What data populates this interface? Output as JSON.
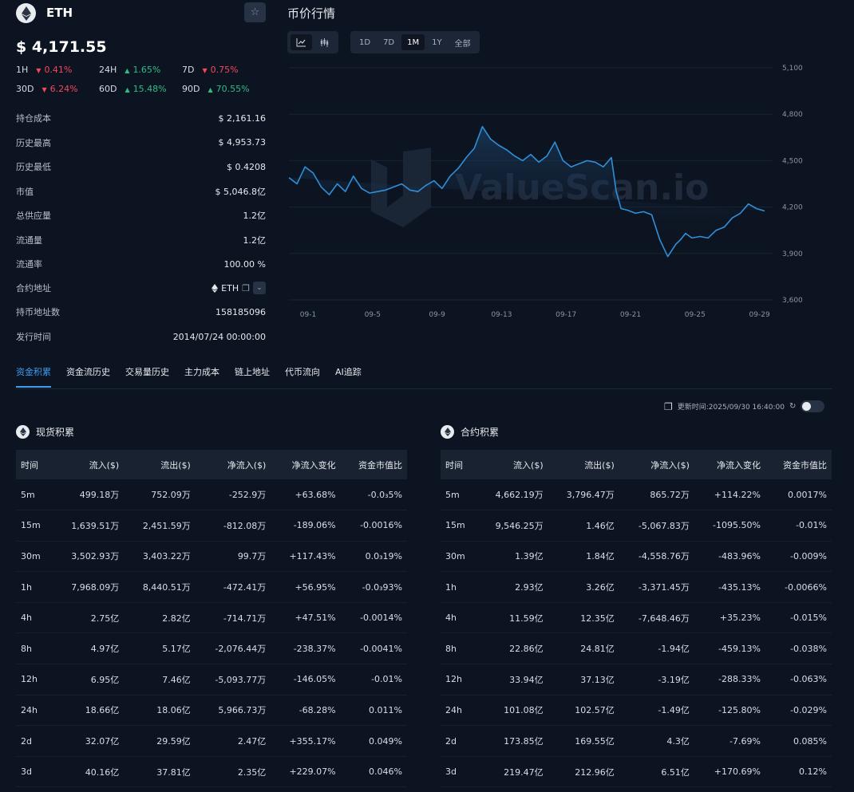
{
  "coin": {
    "symbol": "ETH",
    "price": "$ 4,171.55",
    "changes": [
      {
        "period": "1H",
        "value": "0.41%",
        "dir": "down"
      },
      {
        "period": "24H",
        "value": "1.65%",
        "dir": "up"
      },
      {
        "period": "7D",
        "value": "0.75%",
        "dir": "down"
      },
      {
        "period": "30D",
        "value": "6.24%",
        "dir": "down"
      },
      {
        "period": "60D",
        "value": "15.48%",
        "dir": "up"
      },
      {
        "period": "90D",
        "value": "70.55%",
        "dir": "up"
      }
    ],
    "info": [
      {
        "label": "持仓成本",
        "value": "$ 2,161.16"
      },
      {
        "label": "历史最高",
        "value": "$ 4,953.73"
      },
      {
        "label": "历史最低",
        "value": "$ 0.4208"
      },
      {
        "label": "市值",
        "value": "$ 5,046.8亿"
      },
      {
        "label": "总供应量",
        "value": "1.2亿"
      },
      {
        "label": "流通量",
        "value": "1.2亿"
      },
      {
        "label": "流通率",
        "value": "100.00 %"
      }
    ],
    "contract_label": "合约地址",
    "contract_value": "ETH",
    "holders_label": "持币地址数",
    "holders_value": "158185096",
    "issue_label": "发行时间",
    "issue_value": "2014/07/24 00:00:00"
  },
  "price_chart": {
    "title": "币价行情",
    "chart_types": [
      "line-chart-icon",
      "candlestick-icon"
    ],
    "ranges": [
      "1D",
      "7D",
      "1M",
      "1Y",
      "全部"
    ],
    "active_range": "1M",
    "watermark": "ValueScan.io",
    "line_color": "#2f8fd8"
  },
  "chart_data": {
    "type": "line",
    "x_ticks": [
      "09-1",
      "09-5",
      "09-9",
      "09-13",
      "09-17",
      "09-21",
      "09-25",
      "09-29"
    ],
    "y_ticks": [
      "5,100",
      "4,800",
      "4,500",
      "4,200",
      "3,900",
      "3,600"
    ],
    "ylim": [
      3600,
      5100
    ],
    "x": [
      0,
      0.5,
      1,
      1.5,
      2,
      2.5,
      3,
      3.5,
      4,
      4.5,
      5,
      5.5,
      6,
      6.5,
      7,
      7.5,
      8,
      8.5,
      9,
      9.5,
      10,
      10.5,
      11,
      11.5,
      12,
      12.5,
      13,
      13.5,
      14,
      14.5,
      15,
      15.5,
      16,
      16.5,
      17,
      17.5,
      18,
      18.5,
      19,
      19.5,
      20,
      20.3,
      20.6,
      21,
      21.5,
      22,
      22.5,
      23,
      23.5,
      24,
      24.3,
      24.6,
      25,
      25.5,
      26,
      26.5,
      27,
      27.5,
      28,
      28.5,
      29,
      29.5,
      29.8
    ],
    "values": [
      4390,
      4350,
      4460,
      4420,
      4330,
      4280,
      4350,
      4300,
      4400,
      4320,
      4290,
      4300,
      4310,
      4330,
      4350,
      4310,
      4300,
      4340,
      4370,
      4320,
      4400,
      4450,
      4520,
      4580,
      4720,
      4640,
      4600,
      4570,
      4530,
      4500,
      4540,
      4490,
      4530,
      4620,
      4500,
      4460,
      4480,
      4500,
      4490,
      4460,
      4520,
      4300,
      4190,
      4180,
      4160,
      4170,
      4150,
      3990,
      3880,
      3960,
      3990,
      4030,
      4000,
      4010,
      4000,
      4050,
      4070,
      4130,
      4160,
      4220,
      4190,
      4175
    ]
  },
  "tabs": [
    "资金积累",
    "资金流历史",
    "交易量历史",
    "主力成本",
    "链上地址",
    "代币流向",
    "AI追踪"
  ],
  "active_tab": "资金积累",
  "update_time": "更新时间:2025/09/30 16:40:00",
  "columns": [
    "时间",
    "流入($)",
    "流出($)",
    "净流入($)",
    "净流入变化",
    "资金市值比"
  ],
  "spot": {
    "title": "现货积累",
    "rows": [
      {
        "t": "5m",
        "in": "499.18万",
        "out": "752.09万",
        "net": "-252.9万",
        "chg": "+63.68%",
        "ratio": "-0.0₃5%",
        "net_dir": "down",
        "chg_dir": "up",
        "ratio_dir": "down"
      },
      {
        "t": "15m",
        "in": "1,639.51万",
        "out": "2,451.59万",
        "net": "-812.08万",
        "chg": "-189.06%",
        "ratio": "-0.0016%",
        "net_dir": "down",
        "chg_dir": "down",
        "ratio_dir": "down"
      },
      {
        "t": "30m",
        "in": "3,502.93万",
        "out": "3,403.22万",
        "net": "99.7万",
        "chg": "+117.43%",
        "ratio": "0.0₃19%",
        "net_dir": "up",
        "chg_dir": "up",
        "ratio_dir": "up"
      },
      {
        "t": "1h",
        "in": "7,968.09万",
        "out": "8,440.51万",
        "net": "-472.41万",
        "chg": "+56.95%",
        "ratio": "-0.0₃93%",
        "net_dir": "down",
        "chg_dir": "up",
        "ratio_dir": "down"
      },
      {
        "t": "4h",
        "in": "2.75亿",
        "out": "2.82亿",
        "net": "-714.71万",
        "chg": "+47.51%",
        "ratio": "-0.0014%",
        "net_dir": "down",
        "chg_dir": "up",
        "ratio_dir": "down"
      },
      {
        "t": "8h",
        "in": "4.97亿",
        "out": "5.17亿",
        "net": "-2,076.44万",
        "chg": "-238.37%",
        "ratio": "-0.0041%",
        "net_dir": "down",
        "chg_dir": "down",
        "ratio_dir": "down"
      },
      {
        "t": "12h",
        "in": "6.95亿",
        "out": "7.46亿",
        "net": "-5,093.77万",
        "chg": "-146.05%",
        "ratio": "-0.01%",
        "net_dir": "down",
        "chg_dir": "down",
        "ratio_dir": "down"
      },
      {
        "t": "24h",
        "in": "18.66亿",
        "out": "18.06亿",
        "net": "5,966.73万",
        "chg": "-68.28%",
        "ratio": "0.011%",
        "net_dir": "up",
        "chg_dir": "down",
        "ratio_dir": "up"
      },
      {
        "t": "2d",
        "in": "32.07亿",
        "out": "29.59亿",
        "net": "2.47亿",
        "chg": "+355.17%",
        "ratio": "0.049%",
        "net_dir": "up",
        "chg_dir": "up",
        "ratio_dir": "up"
      },
      {
        "t": "3d",
        "in": "40.16亿",
        "out": "37.81亿",
        "net": "2.35亿",
        "chg": "+229.07%",
        "ratio": "0.046%",
        "net_dir": "up",
        "chg_dir": "up",
        "ratio_dir": "up"
      }
    ]
  },
  "futures": {
    "title": "合约积累",
    "rows": [
      {
        "t": "5m",
        "in": "4,662.19万",
        "out": "3,796.47万",
        "net": "865.72万",
        "chg": "+114.22%",
        "ratio": "0.0017%",
        "net_dir": "up",
        "chg_dir": "up",
        "ratio_dir": "up"
      },
      {
        "t": "15m",
        "in": "9,546.25万",
        "out": "1.46亿",
        "net": "-5,067.83万",
        "chg": "-1095.50%",
        "ratio": "-0.01%",
        "net_dir": "down",
        "chg_dir": "down",
        "ratio_dir": "down"
      },
      {
        "t": "30m",
        "in": "1.39亿",
        "out": "1.84亿",
        "net": "-4,558.76万",
        "chg": "-483.96%",
        "ratio": "-0.009%",
        "net_dir": "down",
        "chg_dir": "down",
        "ratio_dir": "down"
      },
      {
        "t": "1h",
        "in": "2.93亿",
        "out": "3.26亿",
        "net": "-3,371.45万",
        "chg": "-435.13%",
        "ratio": "-0.0066%",
        "net_dir": "down",
        "chg_dir": "down",
        "ratio_dir": "down"
      },
      {
        "t": "4h",
        "in": "11.59亿",
        "out": "12.35亿",
        "net": "-7,648.46万",
        "chg": "+35.23%",
        "ratio": "-0.015%",
        "net_dir": "down",
        "chg_dir": "up",
        "ratio_dir": "down"
      },
      {
        "t": "8h",
        "in": "22.86亿",
        "out": "24.81亿",
        "net": "-1.94亿",
        "chg": "-459.13%",
        "ratio": "-0.038%",
        "net_dir": "down",
        "chg_dir": "down",
        "ratio_dir": "down"
      },
      {
        "t": "12h",
        "in": "33.94亿",
        "out": "37.13亿",
        "net": "-3.19亿",
        "chg": "-288.33%",
        "ratio": "-0.063%",
        "net_dir": "down",
        "chg_dir": "down",
        "ratio_dir": "down"
      },
      {
        "t": "24h",
        "in": "101.08亿",
        "out": "102.57亿",
        "net": "-1.49亿",
        "chg": "-125.80%",
        "ratio": "-0.029%",
        "net_dir": "down",
        "chg_dir": "down",
        "ratio_dir": "down"
      },
      {
        "t": "2d",
        "in": "173.85亿",
        "out": "169.55亿",
        "net": "4.3亿",
        "chg": "-7.69%",
        "ratio": "0.085%",
        "net_dir": "up",
        "chg_dir": "down",
        "ratio_dir": "up"
      },
      {
        "t": "3d",
        "in": "219.47亿",
        "out": "212.96亿",
        "net": "6.51亿",
        "chg": "+170.69%",
        "ratio": "0.12%",
        "net_dir": "up",
        "chg_dir": "up",
        "ratio_dir": "up"
      }
    ]
  }
}
